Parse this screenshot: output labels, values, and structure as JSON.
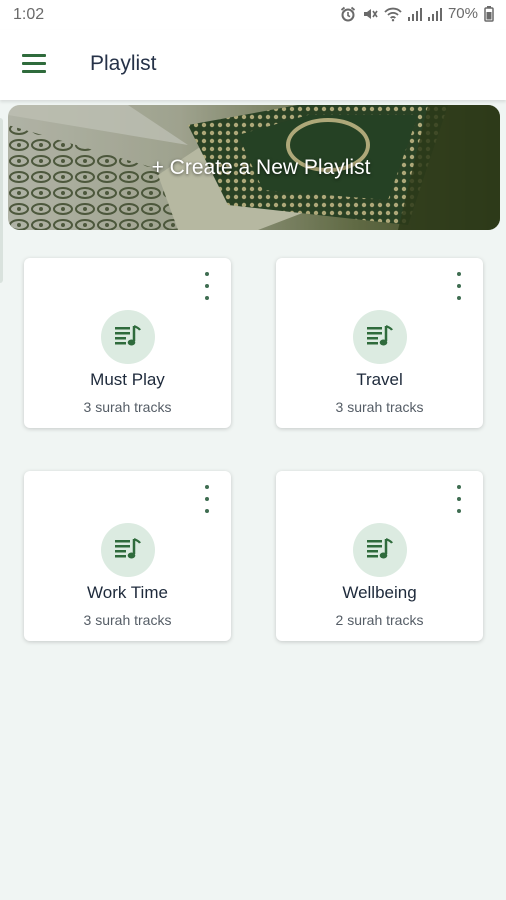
{
  "status_bar": {
    "time": "1:02",
    "battery": "70%"
  },
  "app_bar": {
    "title": "Playlist",
    "menu_icon": "menu-icon"
  },
  "banner": {
    "label": "+ Create a New Playlist"
  },
  "playlists": [
    {
      "name": "Must Play",
      "tracks": "3 surah tracks",
      "icon": "playlist-music-icon"
    },
    {
      "name": "Travel",
      "tracks": "3 surah tracks",
      "icon": "playlist-music-icon"
    },
    {
      "name": "Work Time",
      "tracks": "3 surah tracks",
      "icon": "playlist-music-icon"
    },
    {
      "name": "Wellbeing",
      "tracks": "2 surah tracks",
      "icon": "playlist-music-icon"
    }
  ],
  "colors": {
    "accent": "#2f6b3c",
    "icon_bg": "#dcebe1",
    "background": "#f0f5f3"
  }
}
